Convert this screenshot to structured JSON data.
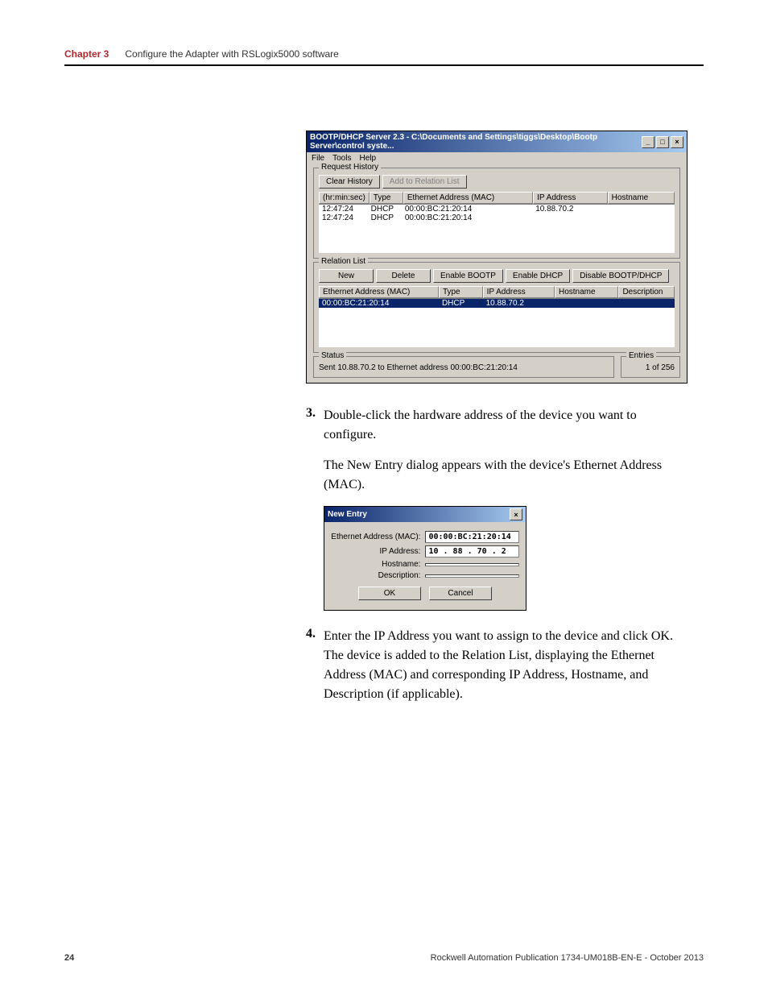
{
  "header": {
    "chapter_label": "Chapter 3",
    "chapter_title": "Configure the Adapter with RSLogix5000 software"
  },
  "bootp_window": {
    "title": "BOOTP/DHCP Server 2.3 - C:\\Documents and Settings\\tiggs\\Desktop\\Bootp Server\\control syste...",
    "menu": [
      "File",
      "Tools",
      "Help"
    ],
    "request_history": {
      "title": "Request History",
      "buttons": {
        "clear": "Clear History",
        "add": "Add to Relation List"
      },
      "columns": {
        "time": "(hr:min:sec)",
        "type": "Type",
        "mac": "Ethernet Address (MAC)",
        "ip": "IP Address",
        "host": "Hostname"
      },
      "rows": [
        {
          "time": "12:47:24",
          "type": "DHCP",
          "mac": "00:00:BC:21:20:14",
          "ip": "10.88.70.2",
          "host": ""
        },
        {
          "time": "12:47:24",
          "type": "DHCP",
          "mac": "00:00:BC:21:20:14",
          "ip": "",
          "host": ""
        }
      ]
    },
    "relation_list": {
      "title": "Relation List",
      "buttons": {
        "new": "New",
        "delete": "Delete",
        "enable_bootp": "Enable BOOTP",
        "enable_dhcp": "Enable DHCP",
        "disable": "Disable BOOTP/DHCP"
      },
      "columns": {
        "mac": "Ethernet Address (MAC)",
        "type": "Type",
        "ip": "IP Address",
        "host": "Hostname",
        "desc": "Description"
      },
      "rows": [
        {
          "mac": "00:00:BC:21:20:14",
          "type": "DHCP",
          "ip": "10.88.70.2",
          "host": "",
          "desc": ""
        }
      ]
    },
    "status": {
      "title": "Status",
      "text": "Sent 10.88.70.2 to Ethernet address 00:00:BC:21:20:14"
    },
    "entries": {
      "title": "Entries",
      "text": "1 of 256"
    }
  },
  "steps": {
    "3": {
      "num": "3.",
      "text": "Double-click the hardware address of the device you want to configure.",
      "followup": "The New Entry dialog appears with the device's Ethernet Address (MAC)."
    },
    "4": {
      "num": "4.",
      "text": "Enter the IP Address you want to assign to the device and click OK. The device is added to the Relation List, displaying the Ethernet Address (MAC) and corresponding IP Address, Hostname, and Description (if applicable)."
    }
  },
  "new_entry": {
    "title": "New Entry",
    "fields": {
      "mac_label": "Ethernet Address (MAC):",
      "mac_value": "00:00:BC:21:20:14",
      "ip_label": "IP Address:",
      "ip_value": "10 . 88 . 70 .  2",
      "host_label": "Hostname:",
      "host_value": "",
      "desc_label": "Description:",
      "desc_value": ""
    },
    "buttons": {
      "ok": "OK",
      "cancel": "Cancel"
    }
  },
  "footer": {
    "page": "24",
    "pub": "Rockwell Automation Publication 1734-UM018B-EN-E - October 2013"
  }
}
